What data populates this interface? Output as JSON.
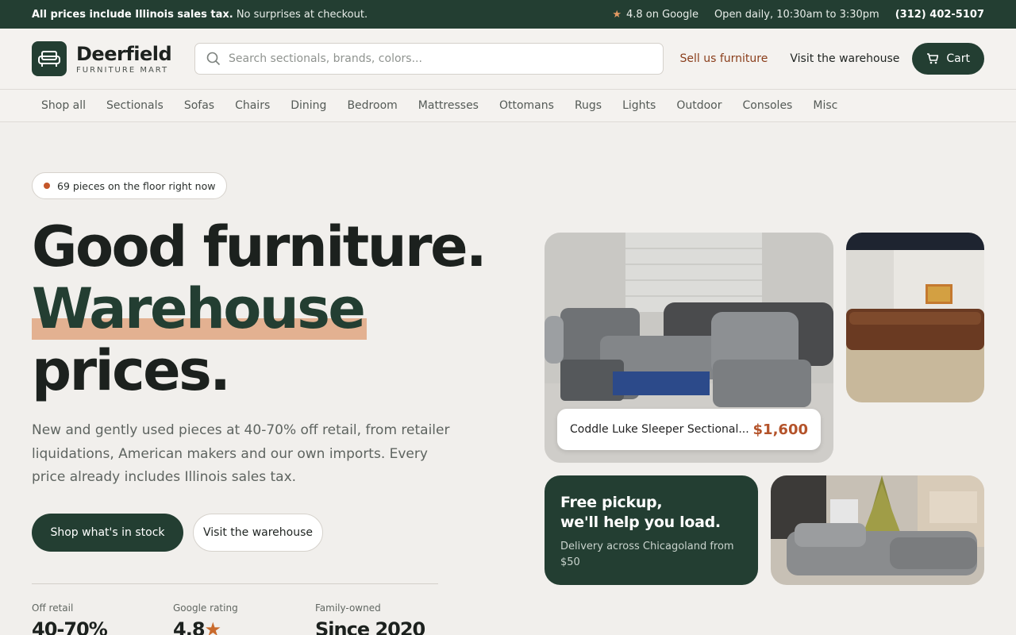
{
  "topbar": {
    "tax_bold": "All prices include Illinois sales tax.",
    "tax_rest": " No surprises at checkout.",
    "rating": "4.8 on Google",
    "hours": "Open daily, 10:30am to 3:30pm",
    "phone": "(312) 402-5107"
  },
  "header": {
    "brand_name": "Deerfield",
    "brand_sub": "FURNITURE MART",
    "search_placeholder": "Search sectionals, brands, colors...",
    "sell_link": "Sell us furniture",
    "visit_link": "Visit the warehouse",
    "cart_label": "Cart"
  },
  "nav": [
    "Shop all",
    "Sectionals",
    "Sofas",
    "Chairs",
    "Dining",
    "Bedroom",
    "Mattresses",
    "Ottomans",
    "Rugs",
    "Lights",
    "Outdoor",
    "Consoles",
    "Misc"
  ],
  "hero": {
    "badge": "69 pieces on the floor right now",
    "line1": "Good furniture.",
    "line2": "Warehouse",
    "line3": "prices.",
    "lead": "New and gently used pieces at 40-70% off retail, from retailer liquidations, American makers and our own imports. Every price already includes Illinois sales tax.",
    "cta_primary": "Shop what's in stock",
    "cta_secondary": "Visit the warehouse"
  },
  "stats": [
    {
      "label": "Off retail",
      "value": "40-70%"
    },
    {
      "label": "Google rating",
      "value": "4.8",
      "star": "★"
    },
    {
      "label": "Family-owned",
      "value": "Since 2020"
    }
  ],
  "featured": {
    "name": "Coddle Luke Sleeper Sectional...",
    "price": "$1,600"
  },
  "promo": {
    "title1": "Free pickup,",
    "title2": "we'll help you load.",
    "sub": "Delivery across Chicagoland from $50"
  },
  "colors": {
    "brand": "#233e32",
    "accent": "#b4532a",
    "highlight": "#e3b191"
  }
}
